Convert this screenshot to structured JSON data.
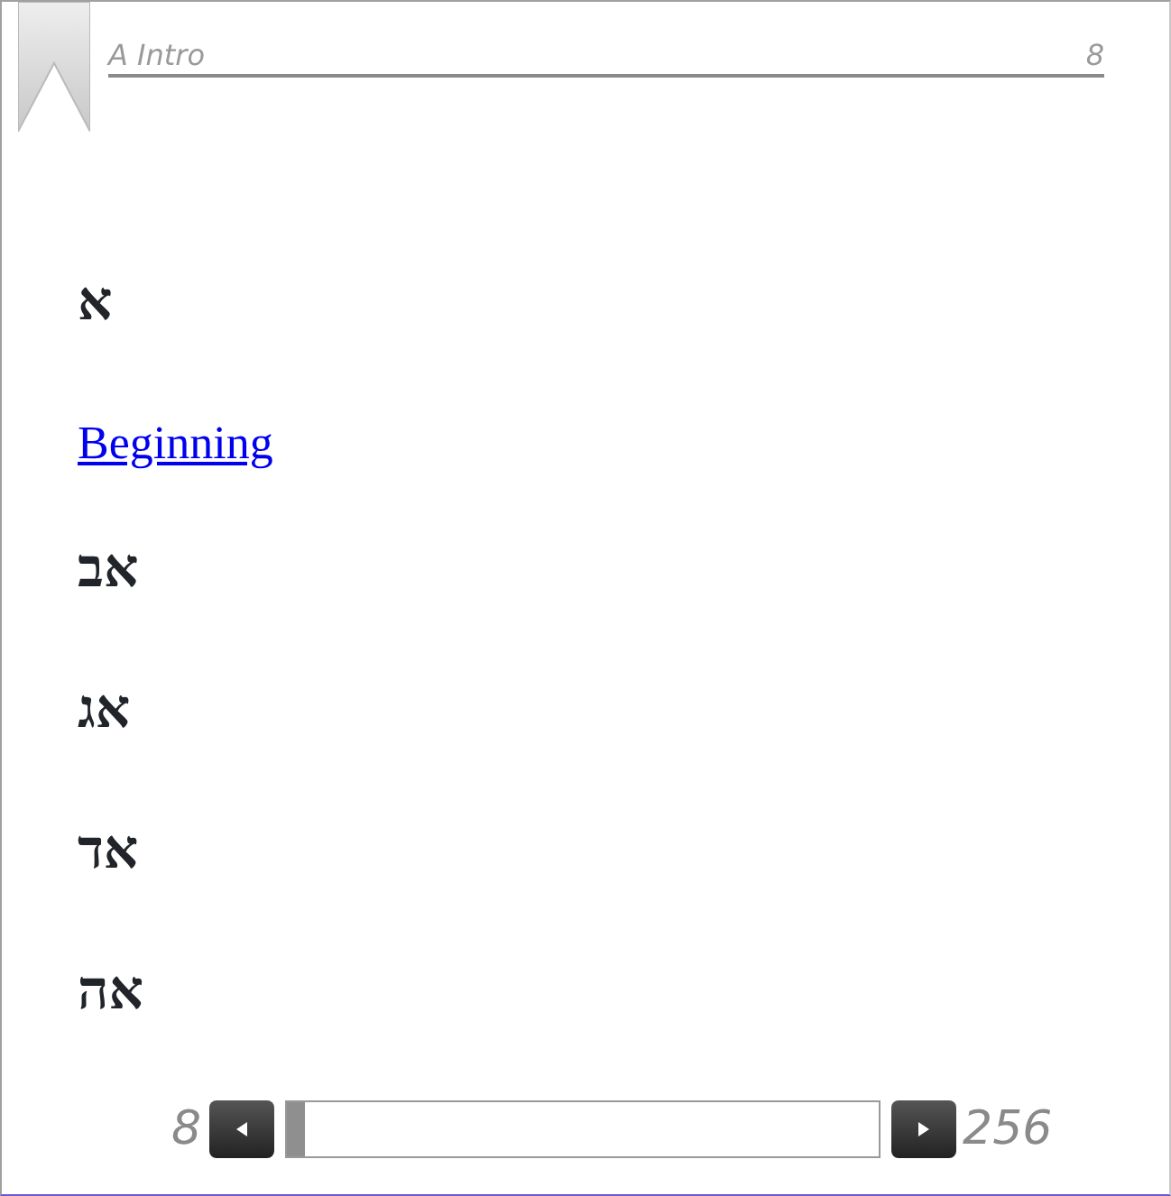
{
  "header": {
    "title": "A Intro",
    "page": "8"
  },
  "content": [
    {
      "kind": "heading",
      "text": "א"
    },
    {
      "kind": "link",
      "text": "Beginning"
    },
    {
      "kind": "heading",
      "text": "אב"
    },
    {
      "kind": "heading",
      "text": "אג"
    },
    {
      "kind": "heading",
      "text": "אד"
    },
    {
      "kind": "heading",
      "text": "אה"
    }
  ],
  "pager": {
    "current": "8",
    "total": "256",
    "level": 0
  }
}
